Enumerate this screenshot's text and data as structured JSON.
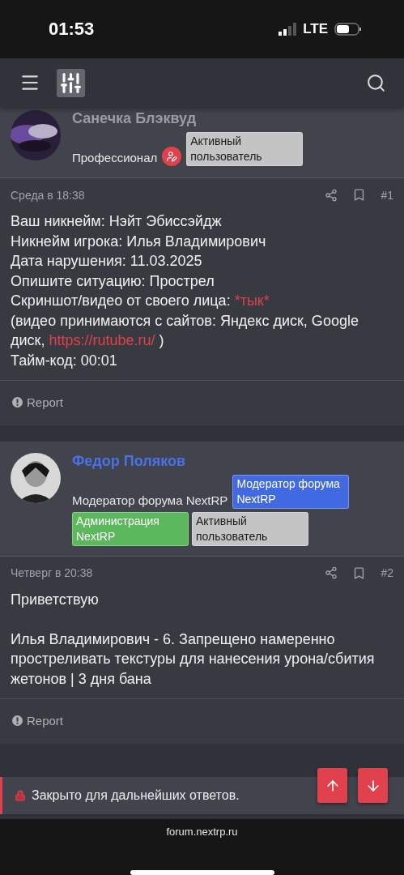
{
  "status_bar": {
    "time": "01:53",
    "network": "LTE"
  },
  "posts": [
    {
      "author": {
        "name": "Санечка Блэквуд",
        "kind": "member",
        "title": "Профессионал",
        "role_icon": true,
        "badges": [
          {
            "label": "Активный пользователь",
            "color": "#c4c4c4"
          }
        ]
      },
      "date": "Среда в 18:38",
      "number": "#1",
      "paragraphs": [
        [
          {
            "kind": "text",
            "text": "Ваш никнейм: Нэйт Эбиссэйдж"
          }
        ],
        [
          {
            "kind": "text",
            "text": "Никнейм игрока: Илья Владимирович"
          }
        ],
        [
          {
            "kind": "text",
            "text": "Дата нарушения: 11.03.2025"
          }
        ],
        [
          {
            "kind": "text",
            "text": "Опишите ситуацию: Прострел"
          }
        ],
        [
          {
            "kind": "text",
            "text": "Скриншот/видео от своего лица: "
          },
          {
            "kind": "link",
            "text": "*тык*"
          }
        ],
        [
          {
            "kind": "text",
            "text": "(видео принимаются с сайтов: Яндекс диск, Google диск, "
          },
          {
            "kind": "link",
            "text": "https://rutube.ru/"
          },
          {
            "kind": "text",
            "text": " )"
          }
        ],
        [
          {
            "kind": "text",
            "text": "Тайм-код: 00:01"
          }
        ]
      ],
      "report": "Report"
    },
    {
      "author": {
        "name": "Федор Поляков",
        "kind": "moderator",
        "title": "Модератор форума NextRP",
        "role_icon": false,
        "badges": [
          {
            "label": "Модератор форума NextRP",
            "color": "#4169e1"
          },
          {
            "label": "Администрация NextRP",
            "color": "#5cb85c"
          },
          {
            "label": "Активный пользователь",
            "color": "#c4c4c4"
          }
        ]
      },
      "date": "Четверг в 20:38",
      "number": "#2",
      "paragraphs": [
        [
          {
            "kind": "text",
            "text": "Приветствую"
          },
          {
            "kind": "break"
          },
          {
            "kind": "break"
          }
        ],
        [
          {
            "kind": "text",
            "text": "Илья Владимирович - 6. Запрещено намеренно простреливать текстуры для нанесения урона/сбития жетонов | 3 дня бана"
          }
        ]
      ],
      "report": "Report"
    }
  ],
  "closed_notice": "Закрыто для дальнейших ответов.",
  "url": "forum.nextrp.ru"
}
